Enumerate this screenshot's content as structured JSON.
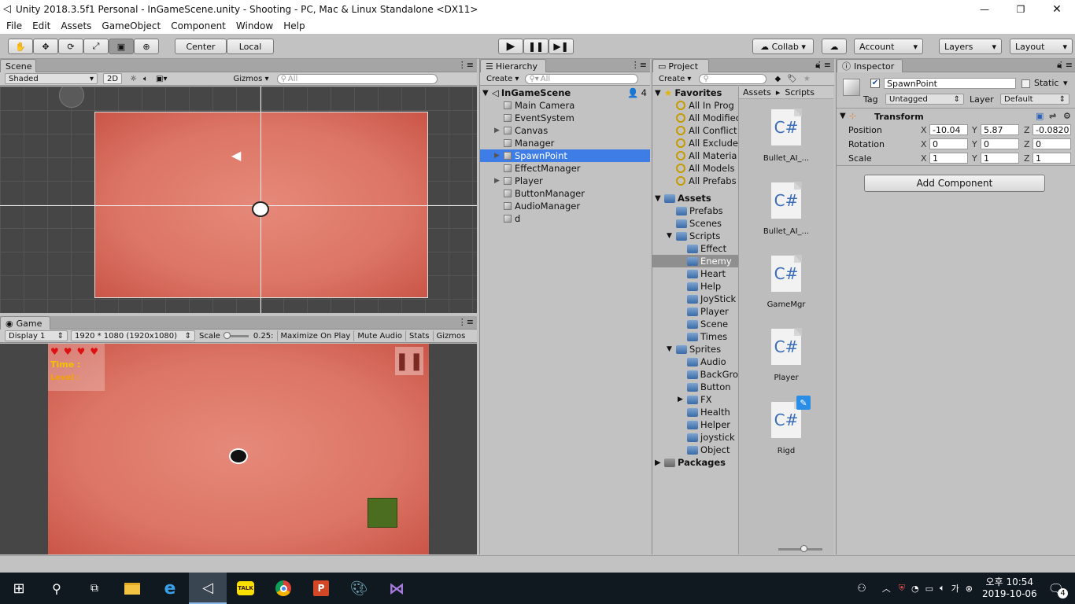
{
  "window": {
    "title": "Unity 2018.3.5f1 Personal - InGameScene.unity - Shooting - PC, Mac & Linux Standalone <DX11>"
  },
  "menu": [
    "File",
    "Edit",
    "Assets",
    "GameObject",
    "Component",
    "Window",
    "Help"
  ],
  "toolbar": {
    "pivot": "Center",
    "space": "Local",
    "collab": "Collab",
    "account": "Account",
    "layers": "Layers",
    "layout": "Layout"
  },
  "scene": {
    "tab": "Scene",
    "shading": "Shaded",
    "mode2d": "2D",
    "gizmos": "Gizmos",
    "search_placeholder": "All"
  },
  "game": {
    "tab": "Game",
    "display": "Display 1",
    "resolution": "1920 * 1080 (1920x1080)",
    "scale_label": "Scale",
    "scale_value": "0.25:",
    "maximize": "Maximize On Play",
    "mute": "Mute Audio",
    "stats": "Stats",
    "gizmos": "Gizmos",
    "hud": {
      "time": "Time :",
      "level": "Level :"
    }
  },
  "hierarchy": {
    "tab": "Hierarchy",
    "create": "Create",
    "search_placeholder": "All",
    "scene": "InGameScene",
    "count": "4",
    "items": [
      {
        "label": "Main Camera",
        "arrow": ""
      },
      {
        "label": "EventSystem",
        "arrow": ""
      },
      {
        "label": "Canvas",
        "arrow": "▶"
      },
      {
        "label": "Manager",
        "arrow": ""
      },
      {
        "label": "SpawnPoint",
        "arrow": "▶",
        "selected": true
      },
      {
        "label": "EffectManager",
        "arrow": ""
      },
      {
        "label": "Player",
        "arrow": "▶"
      },
      {
        "label": "ButtonManager",
        "arrow": ""
      },
      {
        "label": "AudioManager",
        "arrow": ""
      },
      {
        "label": "d",
        "arrow": ""
      }
    ]
  },
  "project": {
    "tab": "Project",
    "create": "Create",
    "favorites": "Favorites",
    "fav_items": [
      "All In Prog",
      "All Modifiec",
      "All Conflict",
      "All Exclude",
      "All Materia",
      "All Models",
      "All Prefabs"
    ],
    "assets": "Assets",
    "tree": [
      {
        "label": "Prefabs",
        "level": 1
      },
      {
        "label": "Scenes",
        "level": 1
      },
      {
        "label": "Scripts",
        "level": 1,
        "arrow": "▼"
      },
      {
        "label": "Effect",
        "level": 2
      },
      {
        "label": "Enemy",
        "level": 2,
        "selected": true
      },
      {
        "label": "Heart",
        "level": 2
      },
      {
        "label": "Help",
        "level": 2
      },
      {
        "label": "JoyStick",
        "level": 2
      },
      {
        "label": "Player",
        "level": 2
      },
      {
        "label": "Scene",
        "level": 2
      },
      {
        "label": "Times",
        "level": 2
      },
      {
        "label": "Sprites",
        "level": 1,
        "arrow": "▼"
      },
      {
        "label": "Audio",
        "level": 2
      },
      {
        "label": "BackGro",
        "level": 2
      },
      {
        "label": "Button",
        "level": 2
      },
      {
        "label": "FX",
        "level": 2,
        "arrow": "▶"
      },
      {
        "label": "Health",
        "level": 2
      },
      {
        "label": "Helper",
        "level": 2
      },
      {
        "label": "joystick",
        "level": 2
      },
      {
        "label": "Object",
        "level": 2
      }
    ],
    "packages": "Packages",
    "breadcrumb": [
      "Assets",
      "Scripts"
    ],
    "files": [
      "Bullet_AI_...",
      "Bullet_AI_...",
      "GameMgr",
      "Player",
      "Rigd"
    ],
    "file_glyph": "C#"
  },
  "inspector": {
    "tab": "Inspector",
    "name": "SpawnPoint",
    "static": "Static",
    "tag_label": "Tag",
    "tag": "Untagged",
    "layer_label": "Layer",
    "layer": "Default",
    "component": "Transform",
    "rows": [
      {
        "label": "Position",
        "x": "-10.04",
        "y": "5.87",
        "z": "-0.0820"
      },
      {
        "label": "Rotation",
        "x": "0",
        "y": "0",
        "z": "0"
      },
      {
        "label": "Scale",
        "x": "1",
        "y": "1",
        "z": "1"
      }
    ],
    "add_component": "Add Component"
  },
  "taskbar": {
    "ime": "오후",
    "time": "10:54",
    "date": "2019-10-06",
    "notifications": "4",
    "talk": "TALK"
  }
}
